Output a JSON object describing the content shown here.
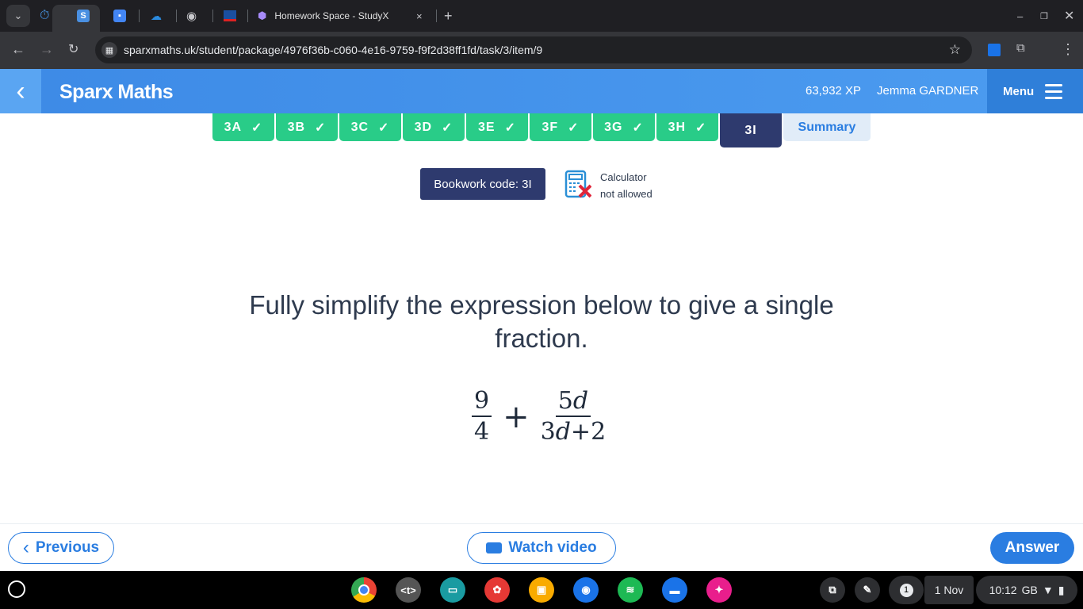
{
  "browser": {
    "active_tab_title": "Homework Space - StudyX",
    "url": "sparxmaths.uk/student/package/4976f36b-c060-4e16-9759-f9f2d38ff1fd/task/3/item/9",
    "new_tab": "+",
    "close": "×",
    "tab_icons": [
      "stopwatch-icon",
      "sparx-s-icon",
      "classroom-icon",
      "onedrive-icon",
      "globe-icon",
      "flag-icon",
      "studyx-gem-icon"
    ]
  },
  "header": {
    "brand": "Sparx Maths",
    "xp": "63,932 XP",
    "user": "Jemma GARDNER",
    "menu": "Menu"
  },
  "tasks": [
    {
      "label": "3A",
      "done": true
    },
    {
      "label": "3B",
      "done": true
    },
    {
      "label": "3C",
      "done": true
    },
    {
      "label": "3D",
      "done": true
    },
    {
      "label": "3E",
      "done": true
    },
    {
      "label": "3F",
      "done": true
    },
    {
      "label": "3G",
      "done": true
    },
    {
      "label": "3H",
      "done": true
    },
    {
      "label": "3I",
      "done": false,
      "current": true
    }
  ],
  "summary": "Summary",
  "bookwork": "Bookwork code: 3I",
  "calculator": {
    "line1": "Calculator",
    "line2": "not allowed"
  },
  "question": {
    "text": "Fully simplify the expression below to give a single fraction.",
    "frac1_num": "9",
    "frac1_den": "4",
    "op": "+",
    "frac2_num_coef": "5",
    "frac2_num_var": "d",
    "frac2_den_a": "3",
    "frac2_den_var": "d",
    "frac2_den_op": "+",
    "frac2_den_b": "2"
  },
  "footer": {
    "previous": "Previous",
    "watch": "Watch video",
    "answer": "Answer"
  },
  "shelf": {
    "notifications": "1",
    "date": "1 Nov",
    "time": "10:12",
    "locale": "GB"
  },
  "colors": {
    "accent": "#2a7de1",
    "done": "#29cc88",
    "current": "#2e3a6e"
  }
}
